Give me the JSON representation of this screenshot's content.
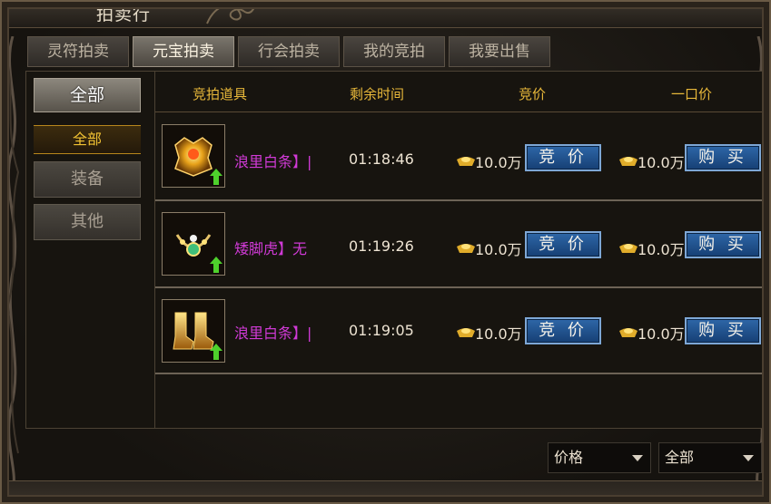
{
  "window": {
    "title": "拍卖行"
  },
  "tabs": [
    {
      "label": "灵符拍卖",
      "active": false
    },
    {
      "label": "元宝拍卖",
      "active": true
    },
    {
      "label": "行会拍卖",
      "active": false
    },
    {
      "label": "我的竞拍",
      "active": false
    },
    {
      "label": "我要出售",
      "active": false
    }
  ],
  "sidebar": {
    "main_category": "全部",
    "selected_sub": "全部",
    "items": [
      {
        "label": "装备"
      },
      {
        "label": "其他"
      }
    ]
  },
  "table": {
    "headers": {
      "item": "竞拍道具",
      "time": "剩余时间",
      "bid": "竞价",
      "buyout": "一口价"
    },
    "rows": [
      {
        "icon": "golden-chest-armor-icon",
        "name": "浪里白条】|",
        "time": "01:18:46",
        "bid_price": "10.0万",
        "bid_label": "竞 价",
        "buy_price": "10.0万",
        "buy_label": "购 买"
      },
      {
        "icon": "jeweled-necklace-icon",
        "name": "矮脚虎】无",
        "time": "01:19:26",
        "bid_price": "10.0万",
        "bid_label": "竞 价",
        "buy_price": "10.0万",
        "buy_label": "购 买"
      },
      {
        "icon": "golden-boots-icon",
        "name": "浪里白条】|",
        "time": "01:19:05",
        "bid_price": "10.0万",
        "bid_label": "竞 价",
        "buy_price": "10.0万",
        "buy_label": "购 买"
      }
    ]
  },
  "filters": {
    "sort": "价格",
    "scope": "全部"
  },
  "colors": {
    "accent_gold": "#e8b83a",
    "item_name": "#d03ad6",
    "button_blue": "#1f4f8c"
  }
}
